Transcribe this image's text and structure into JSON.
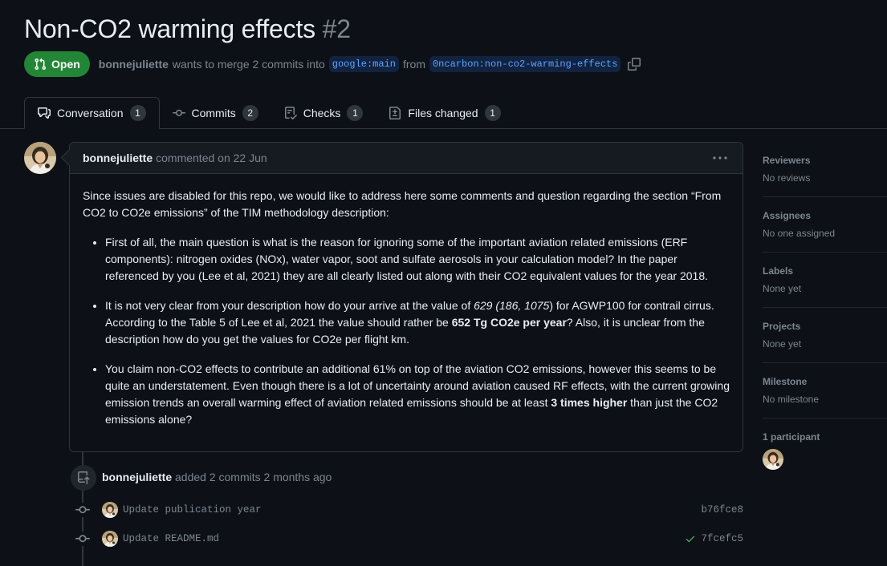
{
  "pr": {
    "title": "Non-CO2 warming effects",
    "number": "#2",
    "state": "Open",
    "author": "bonnejuliette",
    "merge_text": "wants to merge 2 commits into",
    "base_branch": "google:main",
    "from_text": "from",
    "head_branch": "0ncarbon:non-co2-warming-effects"
  },
  "tabs": [
    {
      "label": "Conversation",
      "count": "1",
      "icon": "comment-discussion-icon"
    },
    {
      "label": "Commits",
      "count": "2",
      "icon": "git-commit-icon"
    },
    {
      "label": "Checks",
      "count": "1",
      "icon": "checklist-icon"
    },
    {
      "label": "Files changed",
      "count": "1",
      "icon": "file-diff-icon"
    }
  ],
  "comment": {
    "author": "bonnejuliette",
    "meta": "commented on 22 Jun",
    "intro": "Since issues are disabled for this repo, we would like to address here some comments and question regarding the section “From CO2 to CO2e emissions” of the TIM methodology description:",
    "b1": "First of all, the main question is what is the reason for ignoring some of the important aviation related emissions (ERF components): nitrogen oxides (NOx), water vapor, soot and sulfate aerosols in your calculation model? In the paper referenced by you (Lee et al, 2021) they are all clearly listed out along with their CO2 equivalent values for the year 2018.",
    "b2_a": "It is not very clear from your description how do your arrive at the value of ",
    "b2_em": "629 (186, 1075",
    "b2_b": ") for AGWP100 for contrail cirrus. According to the Table 5 of Lee et al, 2021 the value should rather be ",
    "b2_strong": "652 Tg CO2e per year",
    "b2_c": "? Also, it is unclear from the description how do you get the values for CO2e per flight km.",
    "b3_a": "You claim non-CO2 effects to contribute an additional 61% on top of the aviation CO2 emissions, however this seems to be quite an understatement. Even though there is a lot of uncertainty around aviation caused RF effects, with the current growing emission trends an overall warming effect of aviation related emissions should be at least ",
    "b3_strong": "3 times higher",
    "b3_b": " than just the CO2 emissions alone?"
  },
  "event": {
    "author": "bonnejuliette",
    "text": "added 2 commits 2 months ago"
  },
  "commits": [
    {
      "message": "Update publication year",
      "sha": "b76fce8",
      "status": ""
    },
    {
      "message": "Update README.md",
      "sha": "7fcefc5",
      "status": "success"
    }
  ],
  "sidebar": [
    {
      "title": "Reviewers",
      "value": "No reviews"
    },
    {
      "title": "Assignees",
      "value": "No one assigned"
    },
    {
      "title": "Labels",
      "value": "None yet"
    },
    {
      "title": "Projects",
      "value": "None yet"
    },
    {
      "title": "Milestone",
      "value": "No milestone"
    }
  ],
  "participants": {
    "title": "1 participant"
  },
  "colors": {
    "background": "#0d1117",
    "open_badge": "#238636",
    "branch_text": "#58a6ff",
    "branch_bg": "#122341",
    "success": "#3fb950",
    "muted": "#7d8590"
  }
}
